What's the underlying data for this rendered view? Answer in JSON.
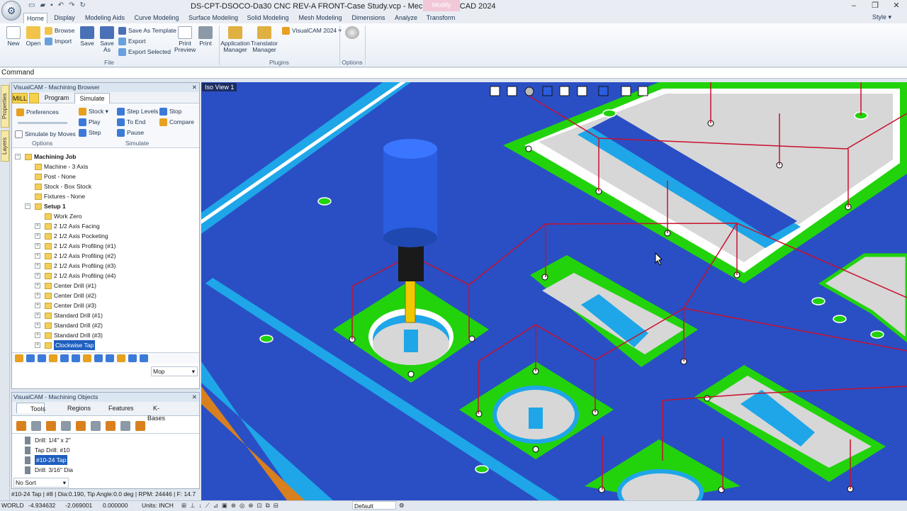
{
  "window": {
    "title": "DS-CPT-DSOCO-Da30 CNC REV-A FRONT-Case Study.vcp - MecSoft VisualCAD 2024",
    "context_tab": "Modify",
    "style_label": "Style"
  },
  "ribbon_tabs": [
    "Home",
    "Display",
    "Modeling Aids",
    "Curve Modeling",
    "Surface Modeling",
    "Solid Modeling",
    "Mesh Modeling",
    "Dimensions",
    "Analyze",
    "Transform"
  ],
  "ribbon": {
    "file": {
      "new": "New",
      "open": "Open",
      "browse": "Browse",
      "import": "Import",
      "save": "Save",
      "save_as": "Save As",
      "save_as_template": "Save As Template",
      "export": "Export",
      "export_selected": "Export Selected",
      "print_preview": "Print Preview",
      "print": "Print",
      "group": "File"
    },
    "plugins": {
      "app_mgr": "Application Manager",
      "trans_mgr": "Translator Manager",
      "visualcam": "VisualCAM 2024",
      "group": "Plugins"
    },
    "options": {
      "group": "Options"
    }
  },
  "command": {
    "label": "Command"
  },
  "sidestrip": {
    "properties": "Properties",
    "layers": "Layers"
  },
  "browser": {
    "title": "VisualCAM - Machining Browser",
    "mill": "MILL",
    "tabs": [
      "Program",
      "Simulate"
    ],
    "sim": {
      "preferences": "Preferences",
      "sim_by_moves": "Simulate by Moves",
      "stock": "Stock",
      "play": "Play",
      "step": "Step",
      "step_levels": "Step Levels",
      "to_end": "To End",
      "pause": "Pause",
      "stop": "Stop",
      "compare": "Compare",
      "options_group": "Options",
      "simulate_group": "Simulate"
    },
    "tree": [
      {
        "label": "Machining Job",
        "lvl": 0,
        "bold": true
      },
      {
        "label": "Machine - 3 Axis",
        "lvl": 1
      },
      {
        "label": "Post - None",
        "lvl": 1
      },
      {
        "label": "Stock - Box Stock",
        "lvl": 1
      },
      {
        "label": "Fixtures - None",
        "lvl": 1
      },
      {
        "label": "Setup 1",
        "lvl": 1,
        "bold": true
      },
      {
        "label": "Work Zero",
        "lvl": 2
      },
      {
        "label": "2 1/2 Axis Facing",
        "lvl": 2
      },
      {
        "label": "2 1/2 Axis Pocketing",
        "lvl": 2
      },
      {
        "label": "2 1/2 Axis Profiling (#1)",
        "lvl": 2
      },
      {
        "label": "2 1/2 Axis Profiling (#2)",
        "lvl": 2
      },
      {
        "label": "2 1/2 Axis Profiling (#3)",
        "lvl": 2
      },
      {
        "label": "2 1/2 Axis Profiling (#4)",
        "lvl": 2
      },
      {
        "label": "Center Drill (#1)",
        "lvl": 2
      },
      {
        "label": "Center Drill (#2)",
        "lvl": 2
      },
      {
        "label": "Center Drill (#3)",
        "lvl": 2
      },
      {
        "label": "Standard Drill (#1)",
        "lvl": 2
      },
      {
        "label": "Standard Drill (#2)",
        "lvl": 2
      },
      {
        "label": "Standard Drill (#3)",
        "lvl": 2
      },
      {
        "label": "Clockwise Tap",
        "lvl": 2,
        "selected": true
      }
    ],
    "mop_select": "Mop"
  },
  "objects": {
    "title": "VisualCAM - Machining Objects",
    "tabs": [
      "Tools",
      "Regions",
      "Features",
      "K-Bases"
    ],
    "list": [
      {
        "label": "Drill: 1/4\" x 2\""
      },
      {
        "label": "Tap Drill: #10"
      },
      {
        "label": "#10-24 Tap",
        "selected": true
      },
      {
        "label": "Drill: 3/16\" Dia"
      }
    ],
    "sort": "No Sort"
  },
  "viewport": {
    "label": "Iso View 1"
  },
  "tool_info": "#10-24 Tap | #8 | Dia:0.190, Tip Angle:0.0 deg | RPM: 24446 | F: 14.7",
  "status": {
    "world": "WORLD",
    "x": "-4.934632",
    "y": "-2.069001",
    "z": "0.000000",
    "units": "Units: INCH",
    "layer": "Default"
  },
  "colors": {
    "stock_blue": "#2a4fc4",
    "face_green": "#22d30c",
    "wall_cyan": "#1ea6e8",
    "floor_grey": "#d7d7d7",
    "path_red": "#c8102e",
    "tool_blue": "#2a5de0",
    "tool_gold": "#f0c800"
  }
}
